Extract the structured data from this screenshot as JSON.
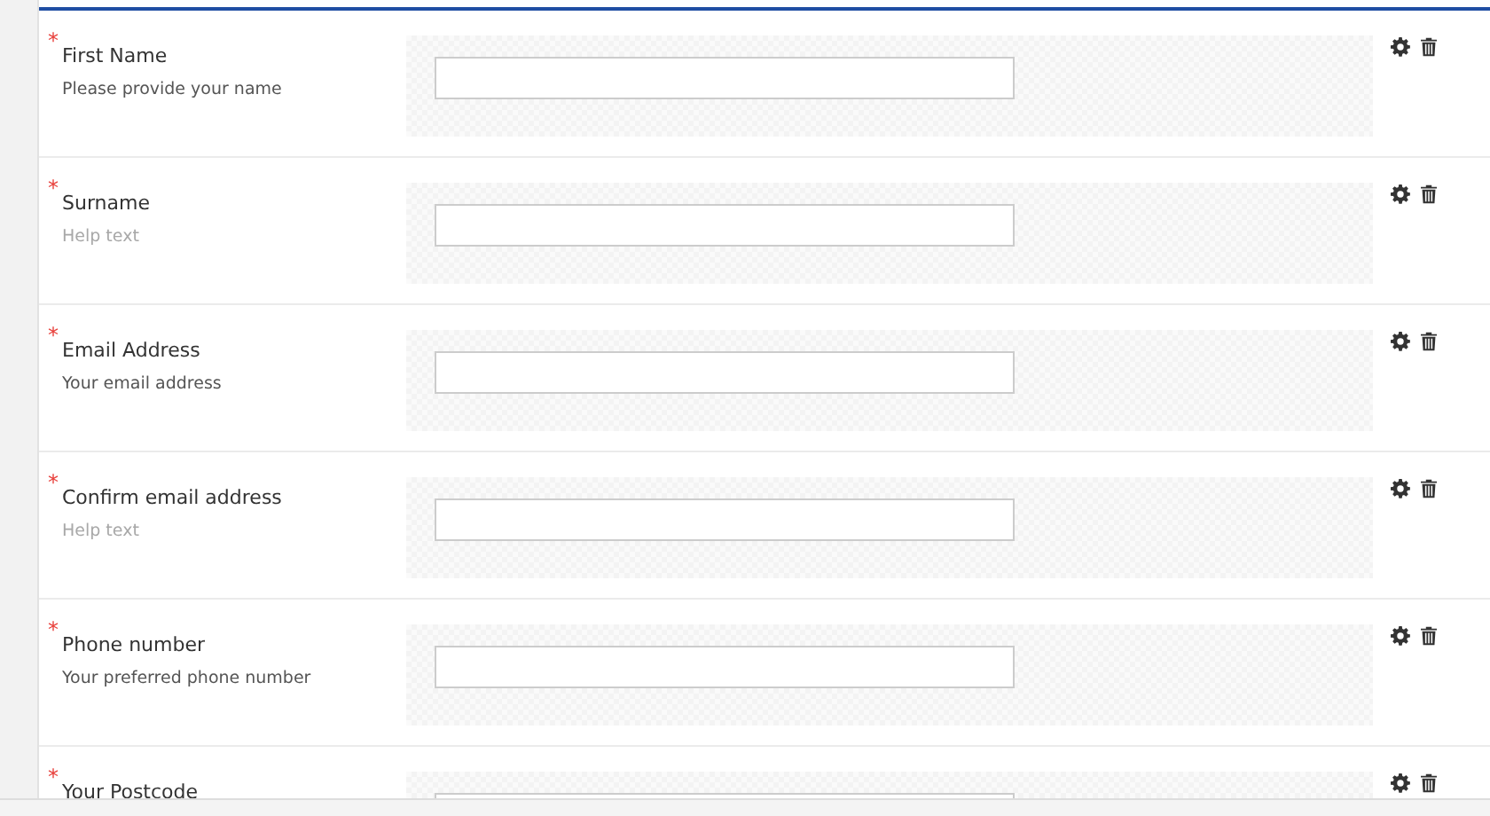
{
  "fields": [
    {
      "label": "First Name",
      "required_mark": "*",
      "help": "Please provide your name",
      "help_muted": false
    },
    {
      "label": "Surname",
      "required_mark": "*",
      "help": "Help text",
      "help_muted": true
    },
    {
      "label": "Email Address",
      "required_mark": "*",
      "help": "Your email address",
      "help_muted": false
    },
    {
      "label": "Confirm email address",
      "required_mark": "*",
      "help": "Help text",
      "help_muted": true
    },
    {
      "label": "Phone number",
      "required_mark": "*",
      "help": "Your preferred phone number",
      "help_muted": false
    },
    {
      "label": "Your Postcode",
      "required_mark": "*"
    }
  ]
}
